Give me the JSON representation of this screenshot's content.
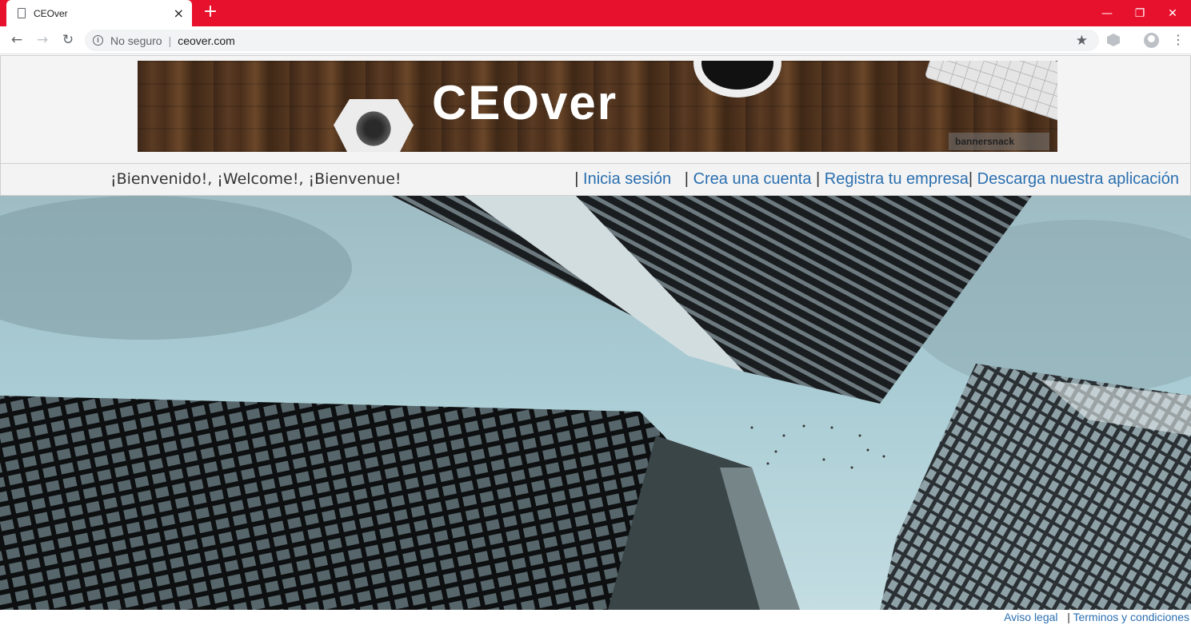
{
  "browser": {
    "tab_title": "CEOver",
    "new_tab_label": "+",
    "close_tab_label": "×",
    "not_secure_label": "No seguro",
    "separator": "|",
    "url": "ceover.com",
    "star_icon": "★",
    "menu_icon": "⋮",
    "window_controls": {
      "minimize": "—",
      "restore": "❐",
      "close": "✕"
    },
    "nav": {
      "back": "←",
      "forward": "→",
      "reload": "↻"
    },
    "colors": {
      "titlebar": "#e8112d"
    }
  },
  "banner": {
    "logo_text": "CEOver",
    "watermark": "bannersnack"
  },
  "welcome": {
    "text": "¡Bienvenido!, ¡Welcome!, ¡Bienvenue!"
  },
  "nav_links": {
    "separator": "|",
    "login": "Inicia sesión",
    "signup": "Crea una cuenta",
    "register_company": "Registra tu empresa",
    "download_app": "Descarga nuestra aplicación"
  },
  "footer": {
    "legal": "Aviso legal",
    "separator": "|",
    "terms": "Terminos y condiciones"
  },
  "colors": {
    "link": "#2a6fb0"
  }
}
